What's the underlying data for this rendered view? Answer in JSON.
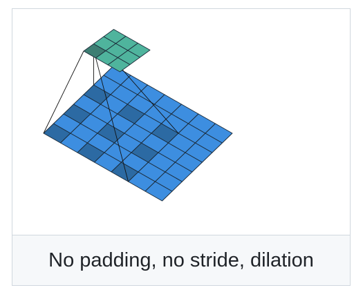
{
  "caption": "No padding, no stride, dilation",
  "diagram": {
    "input_grid_size": 7,
    "kernel_grid_size": 3,
    "dilation": 2,
    "kernel_position": [
      0,
      0
    ],
    "colors": {
      "input_cell": "#3d8ee0",
      "input_cell_active": "#2c6aa3",
      "kernel_cell": "#4fb49d",
      "kernel_cell_active": "#3d7e73",
      "grid_line": "#1b2a38",
      "projection_line": "#111111"
    }
  }
}
